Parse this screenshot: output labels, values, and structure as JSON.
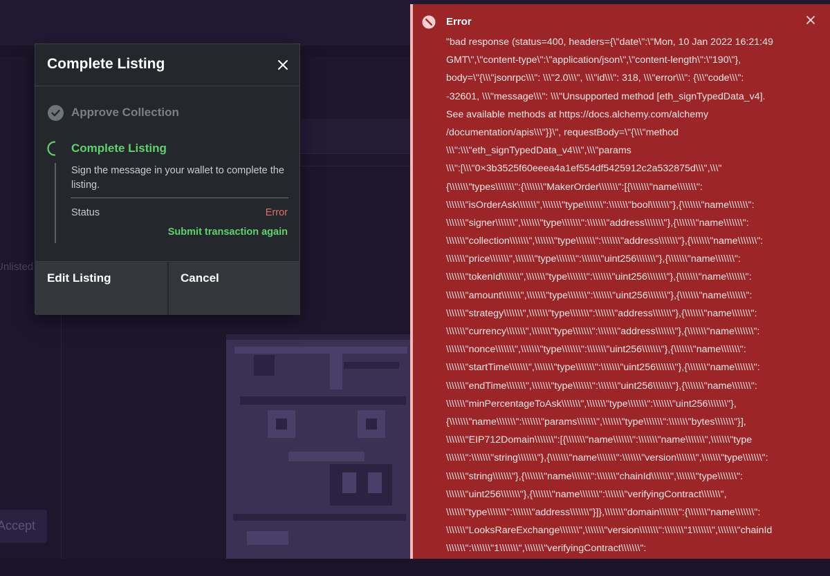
{
  "background": {
    "unlisted_text": "Unlisted",
    "accept_button": "Accept"
  },
  "modal": {
    "title": "Complete Listing",
    "close_icon": "close-icon",
    "steps": [
      {
        "label": "Approve Collection",
        "state": "done",
        "icon": "check-circle-icon"
      },
      {
        "label": "Complete Listing",
        "state": "active",
        "icon": "spinner-icon",
        "description": "Sign the message in your wallet to complete the listing."
      }
    ],
    "status_label": "Status",
    "status_value": "Error",
    "retry_link": "Submit transaction again",
    "edit_button": "Edit Listing",
    "cancel_button": "Cancel"
  },
  "toast": {
    "title": "Error",
    "icon": "no-entry-icon",
    "close_icon": "close-icon",
    "message_lines": [
      "\"bad response (status=400, headers={\\\"date\\\":\\\"Mon, 10 Jan 2022 16:21:49",
      "GMT\\\",\\\"content-type\\\":\\\"application/json\\\",\\\"content-length\\\":\\\"190\\\"},",
      "body=\\\"{\\\\\\\"jsonrpc\\\\\\\": \\\\\\\"2.0\\\\\\\", \\\\\\\"id\\\\\\\": 318, \\\\\\\"error\\\\\\\": {\\\\\\\"code\\\\\\\":",
      "-32601, \\\\\\\"message\\\\\\\": \\\\\\\"Unsupported method [eth_signTypedData_v4].",
      "See available methods at https://docs.alchemy.com/alchemy",
      "/documentation/apis\\\\\\\"}}\\\", requestBody=\\\"{\\\\\\\"method",
      "\\\\\\\":\\\\\\\"eth_signTypedData_v4\\\\\\\",\\\\\\\"params",
      "\\\\\\\":[\\\\\\\"0×3b3525f60eeea4a1ef554df5425912c2a532875d\\\\\\\",\\\\\\\"",
      "{\\\\\\\\\\\\\\\"types\\\\\\\\\\\\\\\":{\\\\\\\\\\\\\\\"MakerOrder\\\\\\\\\\\\\\\":[{\\\\\\\\\\\\\\\"name\\\\\\\\\\\\\\\":",
      "\\\\\\\\\\\\\\\"isOrderAsk\\\\\\\\\\\\\\\",\\\\\\\\\\\\\\\"type\\\\\\\\\\\\\\\":\\\\\\\\\\\\\\\"bool\\\\\\\\\\\\\\\"},{\\\\\\\\\\\\\\\"name\\\\\\\\\\\\\\\":",
      "\\\\\\\\\\\\\\\"signer\\\\\\\\\\\\\\\",\\\\\\\\\\\\\\\"type\\\\\\\\\\\\\\\":\\\\\\\\\\\\\\\"address\\\\\\\\\\\\\\\"},{\\\\\\\\\\\\\\\"name\\\\\\\\\\\\\\\":",
      "\\\\\\\\\\\\\\\"collection\\\\\\\\\\\\\\\",\\\\\\\\\\\\\\\"type\\\\\\\\\\\\\\\":\\\\\\\\\\\\\\\"address\\\\\\\\\\\\\\\"},{\\\\\\\\\\\\\\\"name\\\\\\\\\\\\\\\":",
      "\\\\\\\\\\\\\\\"price\\\\\\\\\\\\\\\",\\\\\\\\\\\\\\\"type\\\\\\\\\\\\\\\":\\\\\\\\\\\\\\\"uint256\\\\\\\\\\\\\\\"},{\\\\\\\\\\\\\\\"name\\\\\\\\\\\\\\\":",
      "\\\\\\\\\\\\\\\"tokenId\\\\\\\\\\\\\\\",\\\\\\\\\\\\\\\"type\\\\\\\\\\\\\\\":\\\\\\\\\\\\\\\"uint256\\\\\\\\\\\\\\\"},{\\\\\\\\\\\\\\\"name\\\\\\\\\\\\\\\":",
      "\\\\\\\\\\\\\\\"amount\\\\\\\\\\\\\\\",\\\\\\\\\\\\\\\"type\\\\\\\\\\\\\\\":\\\\\\\\\\\\\\\"uint256\\\\\\\\\\\\\\\"},{\\\\\\\\\\\\\\\"name\\\\\\\\\\\\\\\":",
      "\\\\\\\\\\\\\\\"strategy\\\\\\\\\\\\\\\",\\\\\\\\\\\\\\\"type\\\\\\\\\\\\\\\":\\\\\\\\\\\\\\\"address\\\\\\\\\\\\\\\"},{\\\\\\\\\\\\\\\"name\\\\\\\\\\\\\\\":",
      "\\\\\\\\\\\\\\\"currency\\\\\\\\\\\\\\\",\\\\\\\\\\\\\\\"type\\\\\\\\\\\\\\\":\\\\\\\\\\\\\\\"address\\\\\\\\\\\\\\\"},{\\\\\\\\\\\\\\\"name\\\\\\\\\\\\\\\":",
      "\\\\\\\\\\\\\\\"nonce\\\\\\\\\\\\\\\",\\\\\\\\\\\\\\\"type\\\\\\\\\\\\\\\":\\\\\\\\\\\\\\\"uint256\\\\\\\\\\\\\\\"},{\\\\\\\\\\\\\\\"name\\\\\\\\\\\\\\\":",
      "\\\\\\\\\\\\\\\"startTime\\\\\\\\\\\\\\\",\\\\\\\\\\\\\\\"type\\\\\\\\\\\\\\\":\\\\\\\\\\\\\\\"uint256\\\\\\\\\\\\\\\"},{\\\\\\\\\\\\\\\"name\\\\\\\\\\\\\\\":",
      "\\\\\\\\\\\\\\\"endTime\\\\\\\\\\\\\\\",\\\\\\\\\\\\\\\"type\\\\\\\\\\\\\\\":\\\\\\\\\\\\\\\"uint256\\\\\\\\\\\\\\\"},{\\\\\\\\\\\\\\\"name\\\\\\\\\\\\\\\":",
      "\\\\\\\\\\\\\\\"minPercentageToAsk\\\\\\\\\\\\\\\",\\\\\\\\\\\\\\\"type\\\\\\\\\\\\\\\":\\\\\\\\\\\\\\\"uint256\\\\\\\\\\\\\\\"},",
      "{\\\\\\\\\\\\\\\"name\\\\\\\\\\\\\\\":\\\\\\\\\\\\\\\"params\\\\\\\\\\\\\\\",\\\\\\\\\\\\\\\"type\\\\\\\\\\\\\\\":\\\\\\\\\\\\\\\"bytes\\\\\\\\\\\\\\\"}],",
      "\\\\\\\\\\\\\\\"EIP712Domain\\\\\\\\\\\\\\\":[{\\\\\\\\\\\\\\\"name\\\\\\\\\\\\\\\":\\\\\\\\\\\\\\\"name\\\\\\\\\\\\\\\",\\\\\\\\\\\\\\\"type",
      "\\\\\\\\\\\\\\\":\\\\\\\\\\\\\\\"string\\\\\\\\\\\\\\\"},{\\\\\\\\\\\\\\\"name\\\\\\\\\\\\\\\":\\\\\\\\\\\\\\\"version\\\\\\\\\\\\\\\",\\\\\\\\\\\\\\\"type\\\\\\\\\\\\\\\":",
      "\\\\\\\\\\\\\\\"string\\\\\\\\\\\\\\\"},{\\\\\\\\\\\\\\\"name\\\\\\\\\\\\\\\":\\\\\\\\\\\\\\\"chainId\\\\\\\\\\\\\\\",\\\\\\\\\\\\\\\"type\\\\\\\\\\\\\\\":",
      "\\\\\\\\\\\\\\\"uint256\\\\\\\\\\\\\\\"},{\\\\\\\\\\\\\\\"name\\\\\\\\\\\\\\\":\\\\\\\\\\\\\\\"verifyingContract\\\\\\\\\\\\\\\",",
      "\\\\\\\\\\\\\\\"type\\\\\\\\\\\\\\\":\\\\\\\\\\\\\\\"address\\\\\\\\\\\\\\\"}]},\\\\\\\\\\\\\\\"domain\\\\\\\\\\\\\\\":{\\\\\\\\\\\\\\\"name\\\\\\\\\\\\\\\":",
      "\\\\\\\\\\\\\\\"LooksRareExchange\\\\\\\\\\\\\\\",\\\\\\\\\\\\\\\"version\\\\\\\\\\\\\\\":\\\\\\\\\\\\\\\"1\\\\\\\\\\\\\\\",\\\\\\\\\\\\\\\"chainId",
      "\\\\\\\\\\\\\\\":\\\\\\\\\\\\\\\"1\\\\\\\\\\\\\\\",\\\\\\\\\\\\\\\"verifyingContract\\\\\\\\\\\\\\\":"
    ]
  },
  "colors": {
    "modal_bg": "#24272b",
    "success_green": "#5fd36b",
    "error_red": "#e66f65",
    "toast_bg": "#9c2527",
    "page_bg": "#1b1428"
  }
}
